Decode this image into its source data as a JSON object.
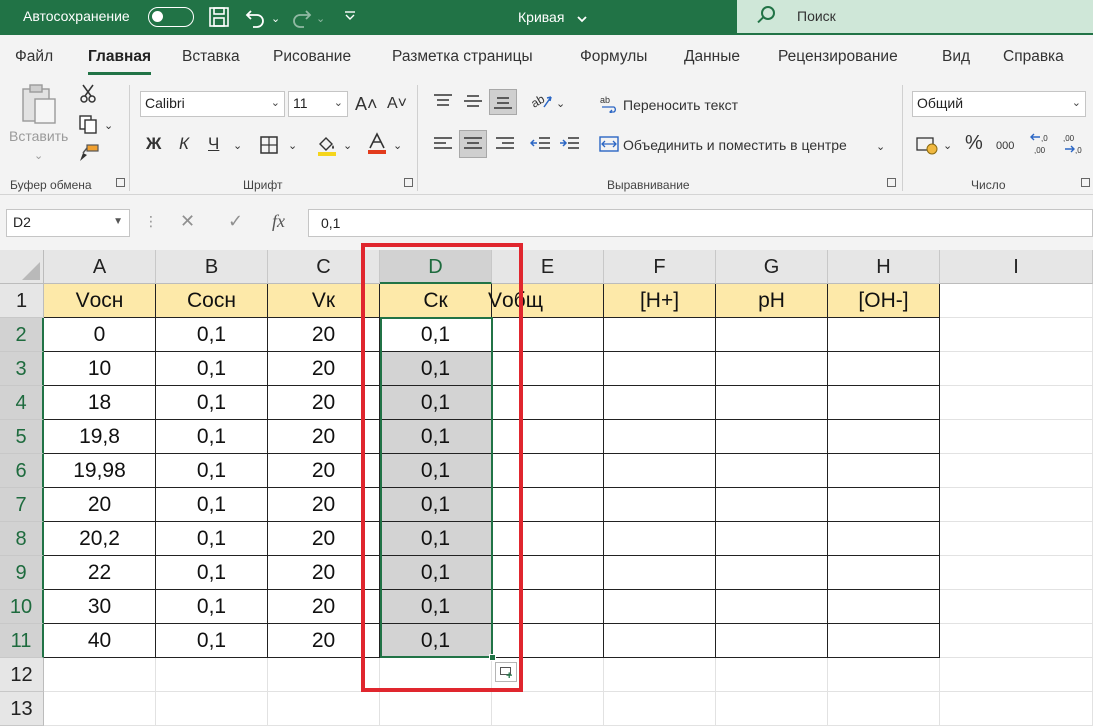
{
  "titlebar": {
    "autosave_label": "Автосохранение",
    "doc_title": "Кривая",
    "search_label": "Поиск",
    "icons": [
      "toggle",
      "save-icon",
      "undo-icon",
      "redo-icon",
      "customize-icon"
    ]
  },
  "menu": {
    "tabs": [
      "Файл",
      "Главная",
      "Вставка",
      "Рисование",
      "Разметка страницы",
      "Формулы",
      "Данные",
      "Рецензирование",
      "Вид",
      "Справка"
    ],
    "active": "Главная"
  },
  "ribbon": {
    "clipboard": {
      "paste_label": "Вставить",
      "group_label": "Буфер обмена"
    },
    "font": {
      "group_label": "Шрифт",
      "font_name": "Calibri",
      "font_size": "11",
      "grow": "A˄",
      "shrink": "A˅",
      "bold": "Ж",
      "italic": "К",
      "underline": "Ч"
    },
    "alignment": {
      "group_label": "Выравнивание",
      "wrap_text": "Переносить текст",
      "merge_center": "Объединить и поместить в центре"
    },
    "number": {
      "group_label": "Число",
      "format": "Общий",
      "percent": "%",
      "thousands": "000",
      "inc_decimal": ",0←\n,00",
      "dec_decimal": ",00\n→,0"
    }
  },
  "formula_bar": {
    "name_box": "D2",
    "cancel": "✕",
    "enter": "✓",
    "fx": "fx",
    "formula": "0,1"
  },
  "sheet": {
    "columns": [
      "A",
      "B",
      "C",
      "D",
      "E",
      "F",
      "G",
      "H",
      "I"
    ],
    "selected_column": "D",
    "rows": [
      "1",
      "2",
      "3",
      "4",
      "5",
      "6",
      "7",
      "8",
      "9",
      "10",
      "11",
      "12",
      "13"
    ],
    "header_row": [
      "Vосн",
      "Сосн",
      "Vк",
      "Ск",
      "Vобщ",
      "[H+]",
      "pH",
      "[OH-]"
    ],
    "data": [
      [
        "0",
        "0,1",
        "20",
        "0,1"
      ],
      [
        "10",
        "0,1",
        "20",
        "0,1"
      ],
      [
        "18",
        "0,1",
        "20",
        "0,1"
      ],
      [
        "19,8",
        "0,1",
        "20",
        "0,1"
      ],
      [
        "19,98",
        "0,1",
        "20",
        "0,1"
      ],
      [
        "20",
        "0,1",
        "20",
        "0,1"
      ],
      [
        "20,2",
        "0,1",
        "20",
        "0,1"
      ],
      [
        "22",
        "0,1",
        "20",
        "0,1"
      ],
      [
        "30",
        "0,1",
        "20",
        "0,1"
      ],
      [
        "40",
        "0,1",
        "20",
        "0,1"
      ]
    ],
    "colors": {
      "header_fill": "#fde9a9",
      "selection": "#217346",
      "highlight_frame": "#e0262e",
      "selected_fill": "#d3d3d3"
    }
  }
}
